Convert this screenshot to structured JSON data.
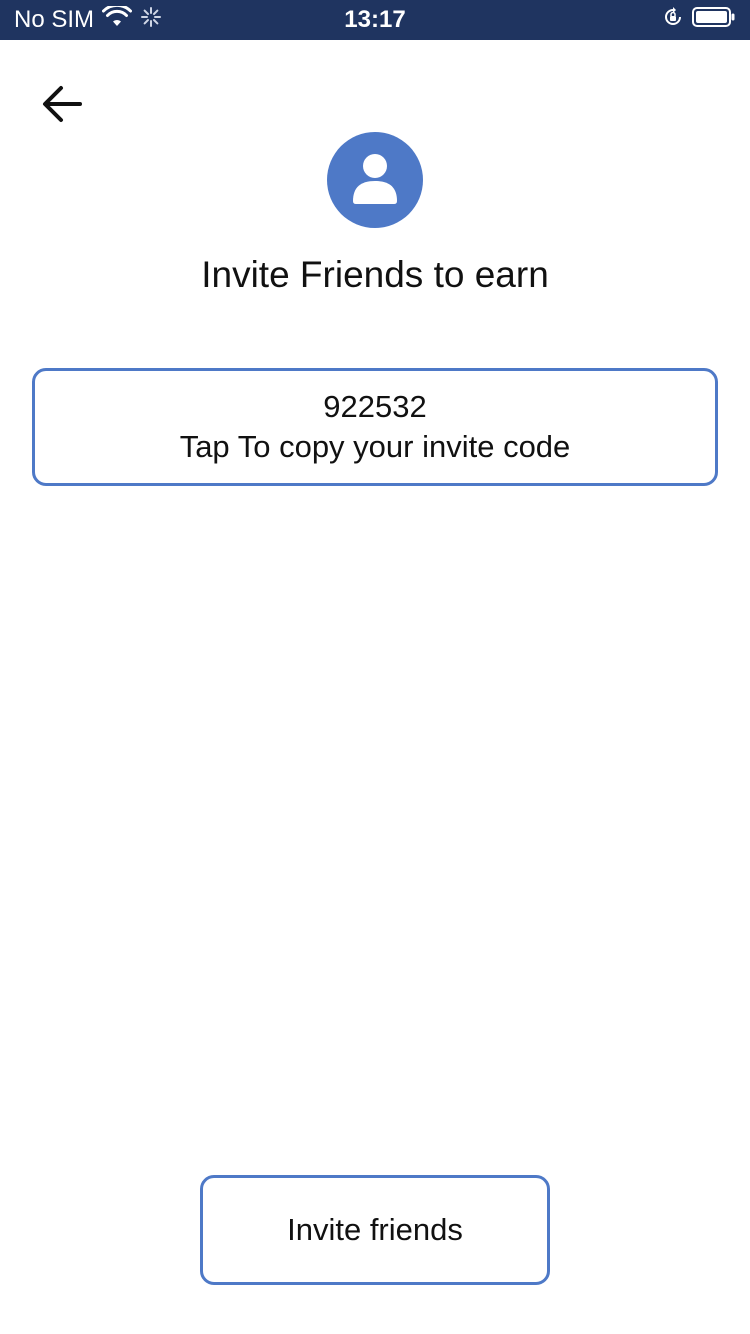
{
  "status_bar": {
    "carrier": "No SIM",
    "time": "13:17",
    "icons": [
      "wifi-icon",
      "activity-spinner-icon",
      "orientation-lock-icon",
      "battery-icon"
    ]
  },
  "header": {
    "back_icon": "arrow-left-icon",
    "avatar_icon": "user-icon",
    "title": "Invite Friends to earn"
  },
  "invite_code": {
    "value": "922532",
    "hint": "Tap To copy your invite code"
  },
  "actions": {
    "invite_label": "Invite friends"
  },
  "colors": {
    "accent": "#4e79c7",
    "status_bar_bg": "#1f3460"
  }
}
